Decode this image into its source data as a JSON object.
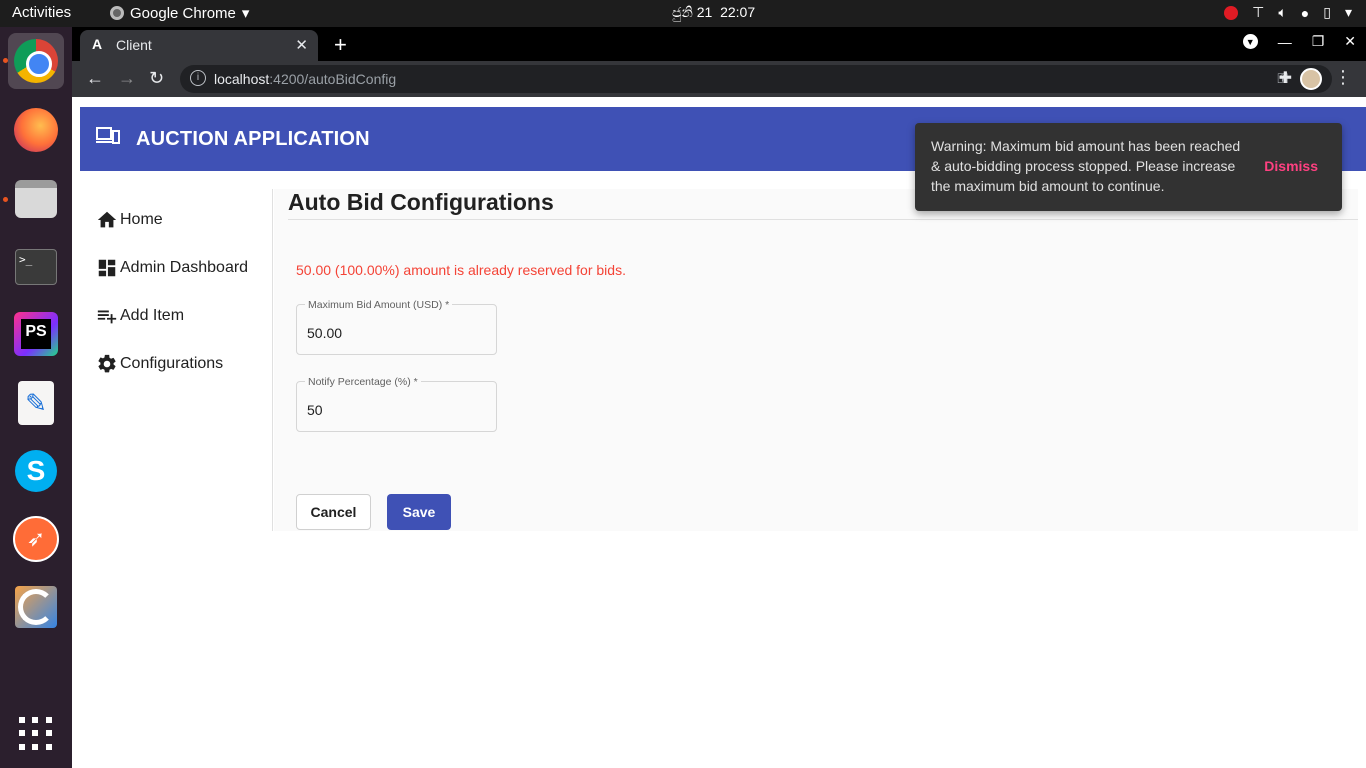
{
  "system": {
    "activities": "Activities",
    "app_name": "Google Chrome",
    "clock_date": "ජුනි 21",
    "clock_time": "22:07"
  },
  "dock": {
    "items": [
      "chrome",
      "firefox",
      "files",
      "terminal",
      "phpstorm",
      "text-editor",
      "skype",
      "postman",
      "blender",
      "show-applications"
    ],
    "terminal_glyph": ">_",
    "phpstorm_glyph": "PS",
    "skype_glyph": "S"
  },
  "browser": {
    "tab_title": "Client",
    "tab_favicon": "A",
    "url_host": "localhost",
    "url_path": ":4200/autoBidConfig"
  },
  "app": {
    "title": "AUCTION APPLICATION",
    "header_color": "#3f51b5"
  },
  "nav": {
    "items": [
      {
        "label": "Home",
        "icon": "home-icon"
      },
      {
        "label": "Admin Dashboard",
        "icon": "dashboard-icon"
      },
      {
        "label": "Add Item",
        "icon": "playlist-add-icon"
      },
      {
        "label": "Configurations",
        "icon": "gear-icon"
      }
    ]
  },
  "main": {
    "heading": "Auto Bid Configurations",
    "reserved_text": "50.00 (100.00%) amount is already reserved for bids.",
    "max_bid": {
      "label": "Maximum Bid Amount (USD) *",
      "value": "50.00"
    },
    "notify": {
      "label": "Notify Percentage (%) *",
      "value": "50"
    },
    "cancel_label": "Cancel",
    "save_label": "Save"
  },
  "snackbar": {
    "message": "Warning: Maximum bid amount has been reached & auto-bidding process stopped. Please increase the maximum bid amount to continue.",
    "action": "Dismiss",
    "action_color": "#ff4081"
  }
}
